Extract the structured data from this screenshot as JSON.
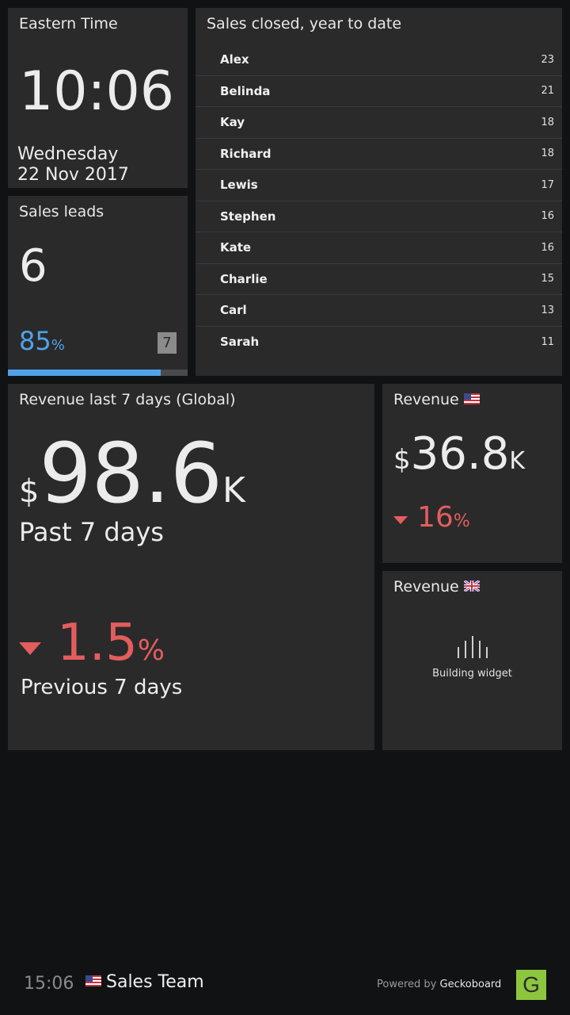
{
  "time_widget": {
    "title": "Eastern Time",
    "clock": "10:06",
    "weekday": "Wednesday",
    "date": "22 Nov 2017"
  },
  "leads_widget": {
    "title": "Sales leads",
    "value": "6",
    "percent": "85",
    "percent_unit": "%",
    "goal": "7",
    "progress": 0.85,
    "bar_color": "#4fa3e8"
  },
  "leaderboard": {
    "title": "Sales closed, year to date",
    "rows": [
      {
        "name": "Alex",
        "value": "23"
      },
      {
        "name": "Belinda",
        "value": "21"
      },
      {
        "name": "Kay",
        "value": "18"
      },
      {
        "name": "Richard",
        "value": "18"
      },
      {
        "name": "Lewis",
        "value": "17"
      },
      {
        "name": "Stephen",
        "value": "16"
      },
      {
        "name": "Kate",
        "value": "16"
      },
      {
        "name": "Charlie",
        "value": "15"
      },
      {
        "name": "Carl",
        "value": "13"
      },
      {
        "name": "Sarah",
        "value": "11"
      }
    ]
  },
  "revenue_global": {
    "title": "Revenue last 7 days (Global)",
    "currency": "$",
    "amount": "98.6",
    "suffix": "K",
    "period_label": "Past 7 days",
    "change": "1.5",
    "change_unit": "%",
    "direction": "down",
    "comparison_label": "Previous 7 days",
    "negative_color": "#e45d5d"
  },
  "revenue_us": {
    "title": "Revenue",
    "flag_icon": "us-flag-icon",
    "currency": "$",
    "amount": "36.8",
    "suffix": "K",
    "change": "16",
    "change_unit": "%",
    "direction": "down"
  },
  "revenue_uk": {
    "title": "Revenue",
    "flag_icon": "uk-flag-icon",
    "status": "Building widget"
  },
  "footer": {
    "time": "15:06",
    "team_flag_icon": "us-flag-icon",
    "team": "Sales Team",
    "powered_prefix": "Powered by",
    "brand": "Geckoboard",
    "logo_letter": "G",
    "logo_color": "#8cc63f"
  }
}
